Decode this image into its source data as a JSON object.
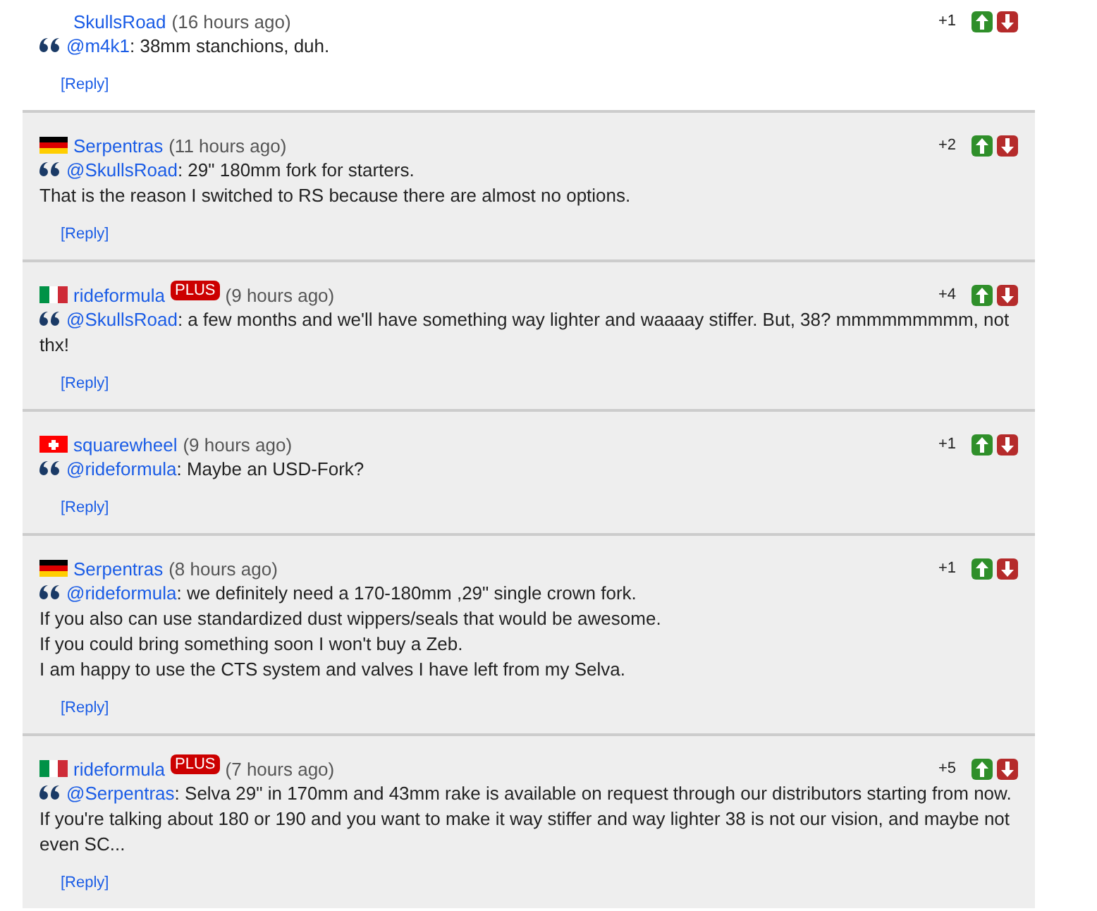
{
  "comments": [
    {
      "shaded": false,
      "user": "SkullsRoad",
      "time": "(16 hours ago)",
      "score": "+1",
      "mention": "@m4k1",
      "text": ": 38mm stanchions, duh.",
      "reply": "[Reply]"
    },
    {
      "shaded": true,
      "flag": {
        "kind": "de"
      },
      "user": "Serpentras",
      "time": "(11 hours ago)",
      "score": "+2",
      "mention": "@SkullsRoad",
      "text": ": 29\" 180mm fork for starters.",
      "more": [
        "That is the reason I switched to RS because there are almost no options."
      ],
      "reply": "[Reply]"
    },
    {
      "shaded": true,
      "flag": {
        "kind": "it"
      },
      "user": "rideformula",
      "badge": "PLUS",
      "time": "(9 hours ago)",
      "score": "+4",
      "mention": "@SkullsRoad",
      "text": ": a few months and we'll have something way lighter and waaaay stiffer. But, 38? mmmmmmmmm, not thx!",
      "reply": "[Reply]"
    },
    {
      "shaded": true,
      "flag": {
        "kind": "ch"
      },
      "user": "squarewheel",
      "time": "(9 hours ago)",
      "score": "+1",
      "mention": "@rideformula",
      "text": ": Maybe an USD-Fork?",
      "reply": "[Reply]"
    },
    {
      "shaded": true,
      "flag": {
        "kind": "de"
      },
      "user": "Serpentras",
      "time": "(8 hours ago)",
      "score": "+1",
      "mention": "@rideformula",
      "text": ": we definitely need a 170-180mm ,29\" single crown fork.",
      "more": [
        "If you also can use standardized dust wippers/seals that would be awesome.",
        "If you could bring something soon I won't buy a Zeb.",
        "I am happy to use the CTS system and valves I have left from my Selva."
      ],
      "reply": "[Reply]"
    },
    {
      "shaded": true,
      "flag": {
        "kind": "it"
      },
      "user": "rideformula",
      "badge": "PLUS",
      "time": "(7 hours ago)",
      "score": "+5",
      "mention": "@Serpentras",
      "text": ": Selva 29\" in 170mm and 43mm rake is available on request through our distributors starting from now.",
      "more": [
        "If you're talking about 180 or 190 and you want to make it way stiffer and way lighter 38 is not our vision, and maybe not even SC..."
      ],
      "reply": "[Reply]"
    }
  ]
}
